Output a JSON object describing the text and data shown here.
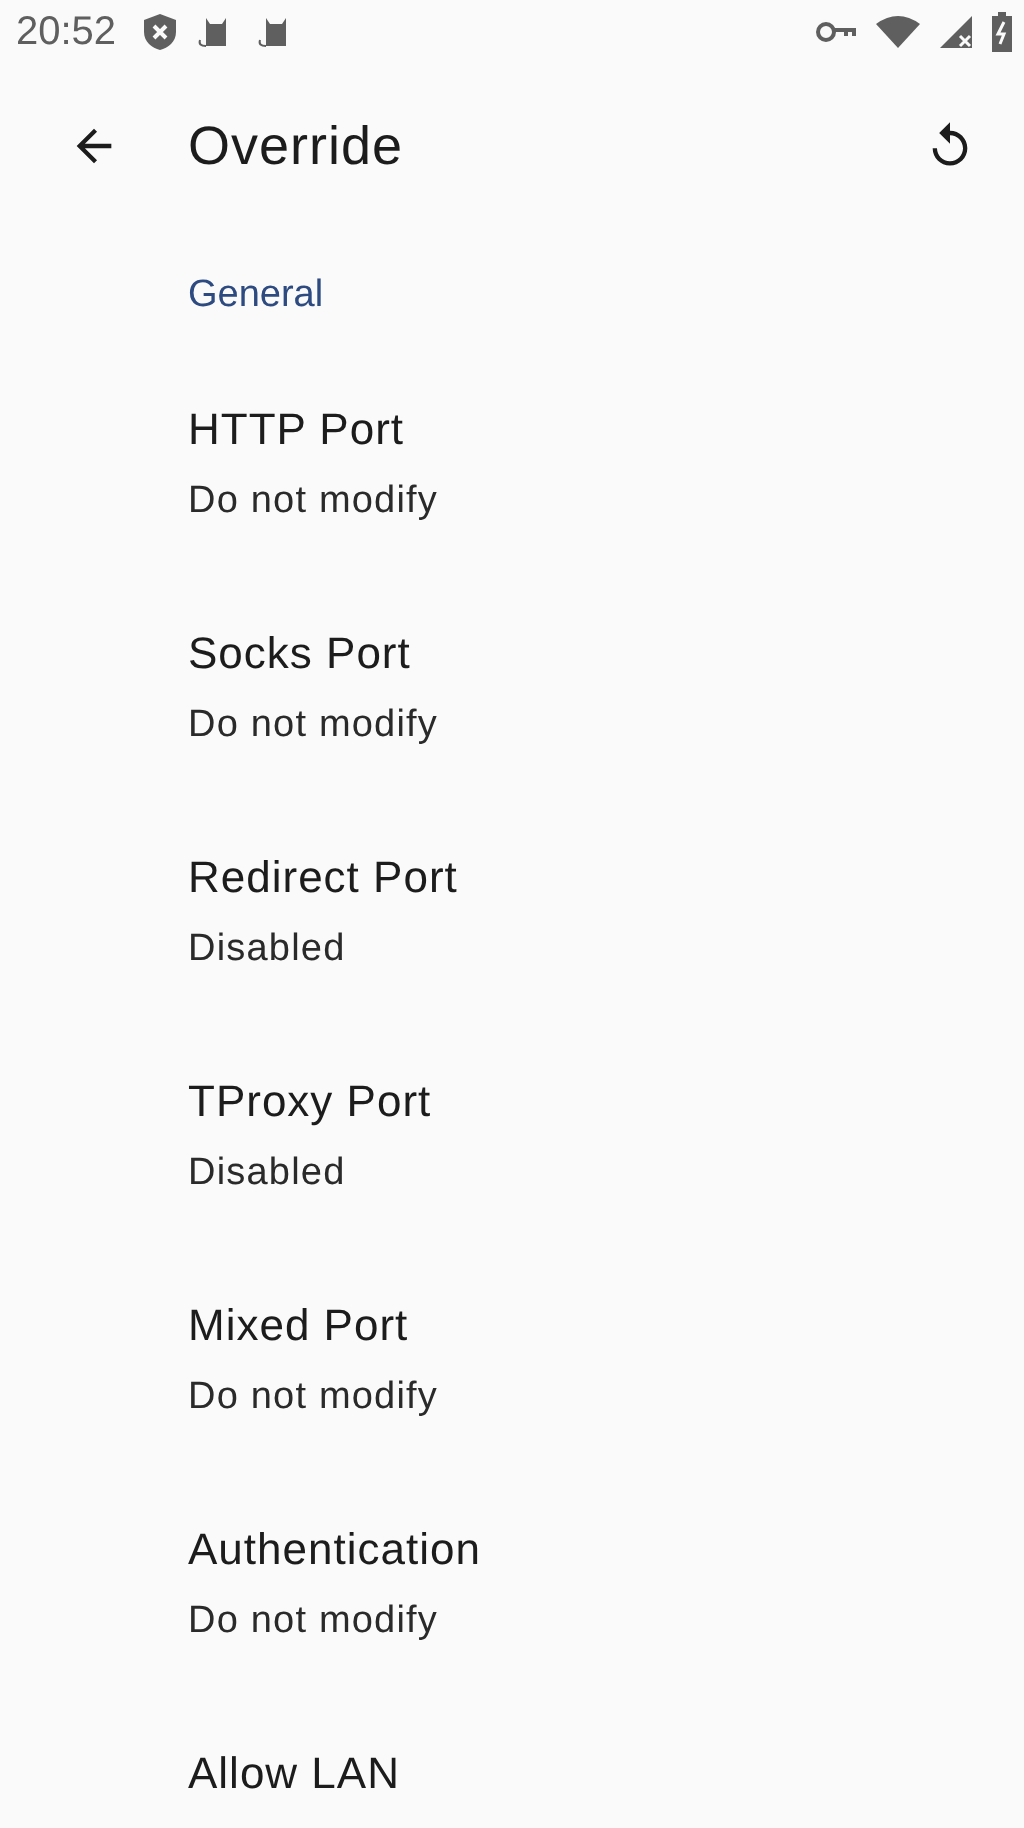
{
  "status_bar": {
    "time": "20:52"
  },
  "app_bar": {
    "title": "Override"
  },
  "sections": [
    {
      "header": "General",
      "items": [
        {
          "title": "HTTP Port",
          "summary": "Do not modify"
        },
        {
          "title": "Socks Port",
          "summary": "Do not modify"
        },
        {
          "title": "Redirect Port",
          "summary": "Disabled"
        },
        {
          "title": "TProxy Port",
          "summary": "Disabled"
        },
        {
          "title": "Mixed Port",
          "summary": "Do not modify"
        },
        {
          "title": "Authentication",
          "summary": "Do not modify"
        },
        {
          "title": "Allow LAN"
        }
      ]
    }
  ]
}
